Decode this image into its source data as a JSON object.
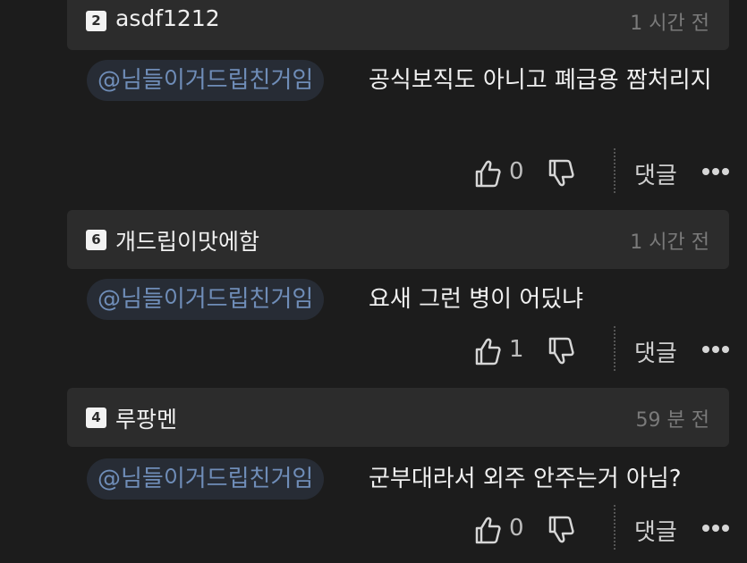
{
  "comments": [
    {
      "level": "2",
      "username": "asdf1212",
      "time": "1 시간 전",
      "mention": "@님들이거드립친거임",
      "text": "공식보직도 아니고 폐급용 짬처리지",
      "likes": "0",
      "reply_label": "댓글"
    },
    {
      "level": "6",
      "username": "개드립이맛에함",
      "time": "1 시간 전",
      "mention": "@님들이거드립친거임",
      "text": "요새 그런 병이 어딨냐",
      "likes": "1",
      "reply_label": "댓글"
    },
    {
      "level": "4",
      "username": "루팡멘",
      "time": "59 분 전",
      "mention": "@님들이거드립친거임",
      "text": "군부대라서 외주 안주는거 아님?",
      "likes": "0",
      "reply_label": "댓글"
    }
  ],
  "icons": {
    "like": "thumbs-up-icon",
    "dislike": "thumbs-down-icon",
    "more": "more-dots-icon"
  }
}
